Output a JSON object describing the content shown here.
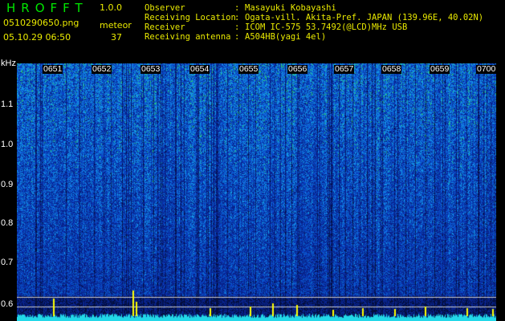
{
  "app": {
    "title": "HROFFT",
    "version": "1.0.0"
  },
  "capture": {
    "filename": "0510290650.png",
    "datetime": "05.10.29 06:50",
    "meteor_label": "meteor",
    "meteor_count": "37"
  },
  "station": {
    "observer_label": "Observer",
    "observer": "Masayuki Kobayashi",
    "location_label": "Receiving Location",
    "location": "Ogata-vill. Akita-Pref. JAPAN (139.96E, 40.02N)",
    "receiver_label": "Receiver",
    "receiver": "ICOM IC-575 53.7492(@LCD)MHz USB",
    "antenna_label": "Receiving antenna",
    "antenna": "A504HB(yagi 4el)",
    "colon": ":"
  },
  "spectrogram": {
    "y_unit": "kHz",
    "time_ticks": [
      "0651",
      "0652",
      "0653",
      "0654",
      "0655",
      "0656",
      "0657",
      "0658",
      "0659",
      "0700"
    ],
    "freq_ticks": [
      "1.1",
      "1.0",
      "0.9",
      "0.8",
      "0.7",
      "0.6"
    ],
    "colors": {
      "background": "#000000",
      "noise_low": "#0b2f9a",
      "noise_mid": "#1f6fe0",
      "noise_high": "#2fd08a",
      "hot": "#ffff00",
      "baseline": "#22d8e8",
      "header_text": "#eaea00",
      "title_text": "#00e600"
    }
  }
}
